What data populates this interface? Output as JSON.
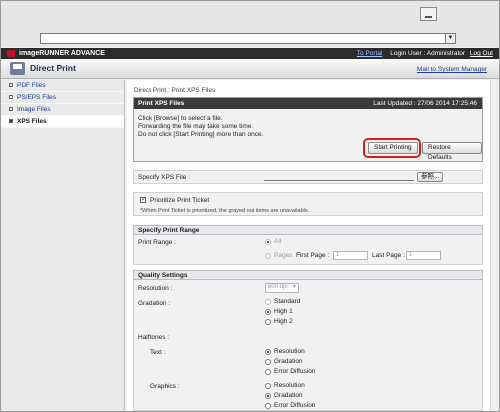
{
  "browser": {
    "address_value": "",
    "dropdown_glyph": "▼"
  },
  "header": {
    "brand": "imageRUNNER ADVANCE",
    "portal_link": "To Portal",
    "login_user": "Login User : Administrator",
    "logout": "Log Out"
  },
  "subheader": {
    "title": "Direct Print",
    "mail_link": "Mail to System Manager"
  },
  "sidebar": {
    "items": [
      {
        "label": "PDF Files"
      },
      {
        "label": "PS/EPS Files"
      },
      {
        "label": "Image Files"
      },
      {
        "label": "XPS Files"
      }
    ]
  },
  "main": {
    "breadcrumb": "Direct Print : Print XPS Files",
    "panel": {
      "title": "Print XPS Files",
      "last_updated": "Last Updated : 27/06 2014 17:25:46",
      "lines": [
        "Click [Browse] to select a file.",
        "Forwarding the file may take some time.",
        "Do not click [Start Printing] more than once."
      ],
      "start_button": "Start Printing",
      "restore_button": "Restore Defaults"
    },
    "specify_file": {
      "label": "Specify XPS File :",
      "browse": "参照..."
    },
    "ticket": {
      "label": "Prioritize Print Ticket",
      "note": "*When Print Ticket is prioritized, the grayed out items are unavailable."
    },
    "range": {
      "heading": "Specify Print Range",
      "label": "Print Range :",
      "all": "All",
      "pages": "Pages",
      "first_label": "First Page :",
      "first_value": "1",
      "last_label": "Last Page :",
      "last_value": "1"
    },
    "quality": {
      "heading": "Quality Settings",
      "resolution_label": "Resolution :",
      "resolution_value": "600 dpi",
      "gradation_label": "Gradation :",
      "gradation_options": [
        "Standard",
        "High 1",
        "High 2"
      ],
      "halftones_label": "Halftones :",
      "text_label": "Text :",
      "text_options": [
        "Resolution",
        "Gradation",
        "Error Diffusion"
      ],
      "graphics_label": "Graphics :",
      "graphics_options": [
        "Resolution",
        "Gradation",
        "Error Diffusion"
      ]
    }
  }
}
